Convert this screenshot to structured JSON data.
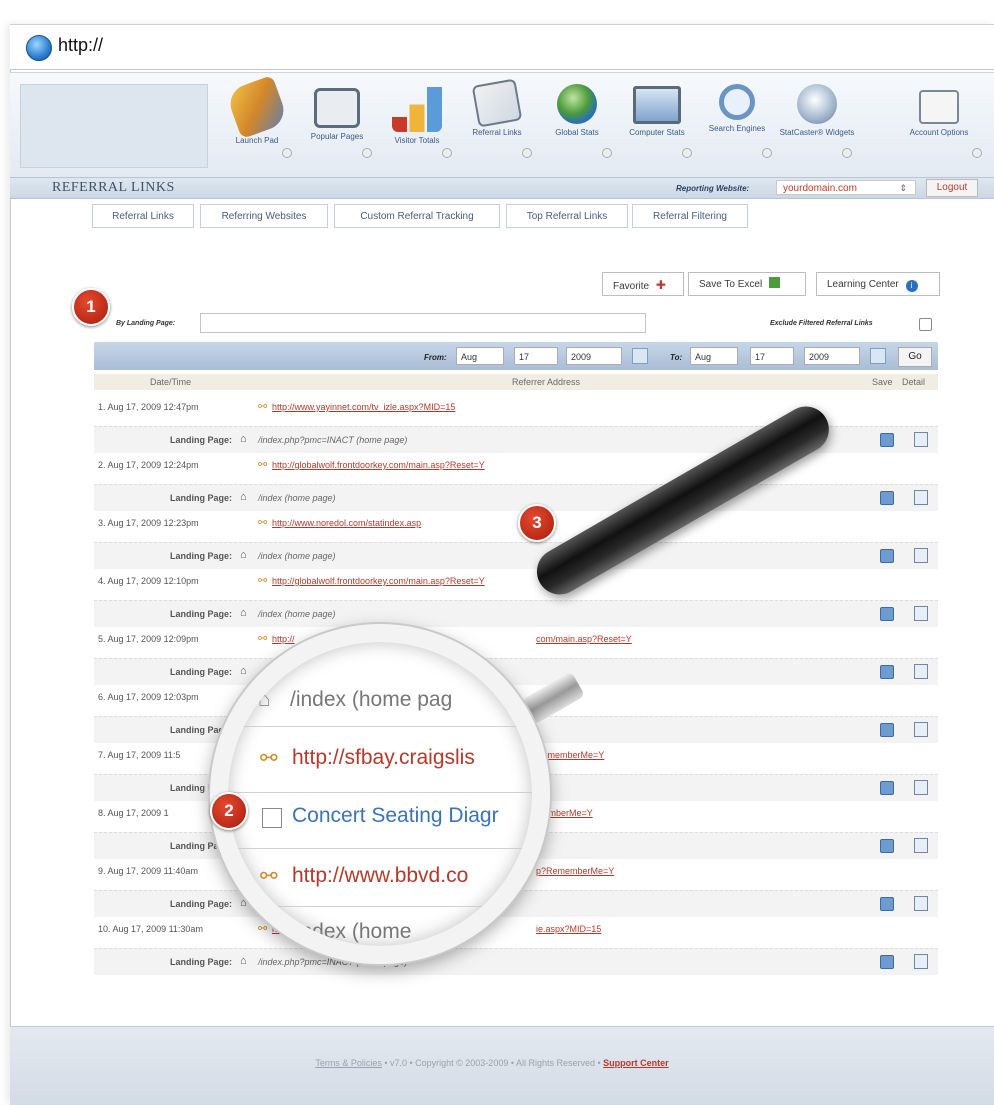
{
  "browser": {
    "url": "http://"
  },
  "nav": {
    "items": [
      {
        "label": "Launch Pad",
        "icon": "rocket-icon"
      },
      {
        "label": "Popular Pages",
        "icon": "pages-icon"
      },
      {
        "label": "Visitor Totals",
        "icon": "bar-chart-icon"
      },
      {
        "label": "Referral Links",
        "icon": "referral-icon"
      },
      {
        "label": "Global Stats",
        "icon": "globe-icon"
      },
      {
        "label": "Computer Stats",
        "icon": "monitor-icon"
      },
      {
        "label": "Search Engines",
        "icon": "magnifier-icon"
      },
      {
        "label": "StatCaster® Widgets",
        "icon": "satellite-icon"
      },
      {
        "label": "Account Options",
        "icon": "settings-icon"
      }
    ]
  },
  "header": {
    "title": "REFERRAL LINKS",
    "reporting_label": "Reporting Website:",
    "reporting_value": "yourdomain.com",
    "logout": "Logout"
  },
  "tabs": [
    "Referral Links",
    "Referring Websites",
    "Custom Referral Tracking",
    "Top Referral Links",
    "Referral Filtering"
  ],
  "toolbar": {
    "favorite": "Favorite",
    "save_excel": "Save To Excel",
    "learning": "Learning Center"
  },
  "filter": {
    "landing_label": "By Landing Page:",
    "exclude_label": "Exclude Filtered Referral Links"
  },
  "datebar": {
    "from": "From:",
    "to": "To:",
    "from_month": "Aug",
    "from_day": "17",
    "from_year": "2009",
    "to_month": "Aug",
    "to_day": "17",
    "to_year": "2009",
    "go": "Go"
  },
  "columns": {
    "datetime": "Date/Time",
    "referrer": "Referrer Address",
    "save": "Save",
    "detail": "Detail"
  },
  "landing_label": "Landing Page:",
  "rows": [
    {
      "num": "1.",
      "time": "Aug 17, 2009 12:47pm",
      "url": "http://www.yayinnet.com/tv_izle.aspx?MID=15",
      "landing": "/index.php?pmc=INACT (home page)"
    },
    {
      "num": "2.",
      "time": "Aug 17, 2009 12:24pm",
      "url": "http://globalwolf.frontdoorkey.com/main.asp?Reset=Y",
      "landing": "/index (home page)"
    },
    {
      "num": "3.",
      "time": "Aug 17, 2009 12:23pm",
      "url": "http://www.noredol.com/statindex.asp",
      "landing": "/index (home page)"
    },
    {
      "num": "4.",
      "time": "Aug 17, 2009 12:10pm",
      "url": "http://globalwolf.frontdoorkey.com/main.asp?Reset=Y",
      "landing": "/index (home page)"
    },
    {
      "num": "5.",
      "time": "Aug 17, 2009 12:09pm",
      "url": "http://",
      "url2": "com/main.asp?Reset=Y",
      "landing": ""
    },
    {
      "num": "6.",
      "time": "Aug 17, 2009 12:03pm",
      "url": "",
      "landing": ""
    },
    {
      "num": "7.",
      "time": "Aug 17, 2009 11:5",
      "url": "",
      "url2": "RememberMe=Y",
      "landing": ""
    },
    {
      "num": "8.",
      "time": "Aug 17, 2009 1",
      "url": "",
      "url2": "memberMe=Y",
      "landing": ""
    },
    {
      "num": "9.",
      "time": "Aug 17, 2009 11:40am",
      "url": "",
      "url2": "p?RememberMe=Y",
      "landing": ""
    },
    {
      "num": "10.",
      "time": "Aug 17, 2009 11:30am",
      "url": "http://www.",
      "url2": "ie.aspx?MID=15",
      "landing": "/index.php?pmc=INACT (home page)"
    }
  ],
  "lens": {
    "line1": "/index (home pag",
    "line2": "http://sfbay.craigslis",
    "line3": "Concert Seating Diagr",
    "line4": "http://www.bbvd.co",
    "line5": "/index (home"
  },
  "badges": [
    "1",
    "2",
    "3"
  ],
  "footer": {
    "terms": "Terms & Policies",
    "middle": " • v7.0 • Copyright © 2003-2009 • All Rights Reserved • ",
    "support": "Support Center"
  },
  "colors": {
    "link": "#b5392a",
    "accent": "#3a5a8a",
    "badge": "#c0311b"
  }
}
